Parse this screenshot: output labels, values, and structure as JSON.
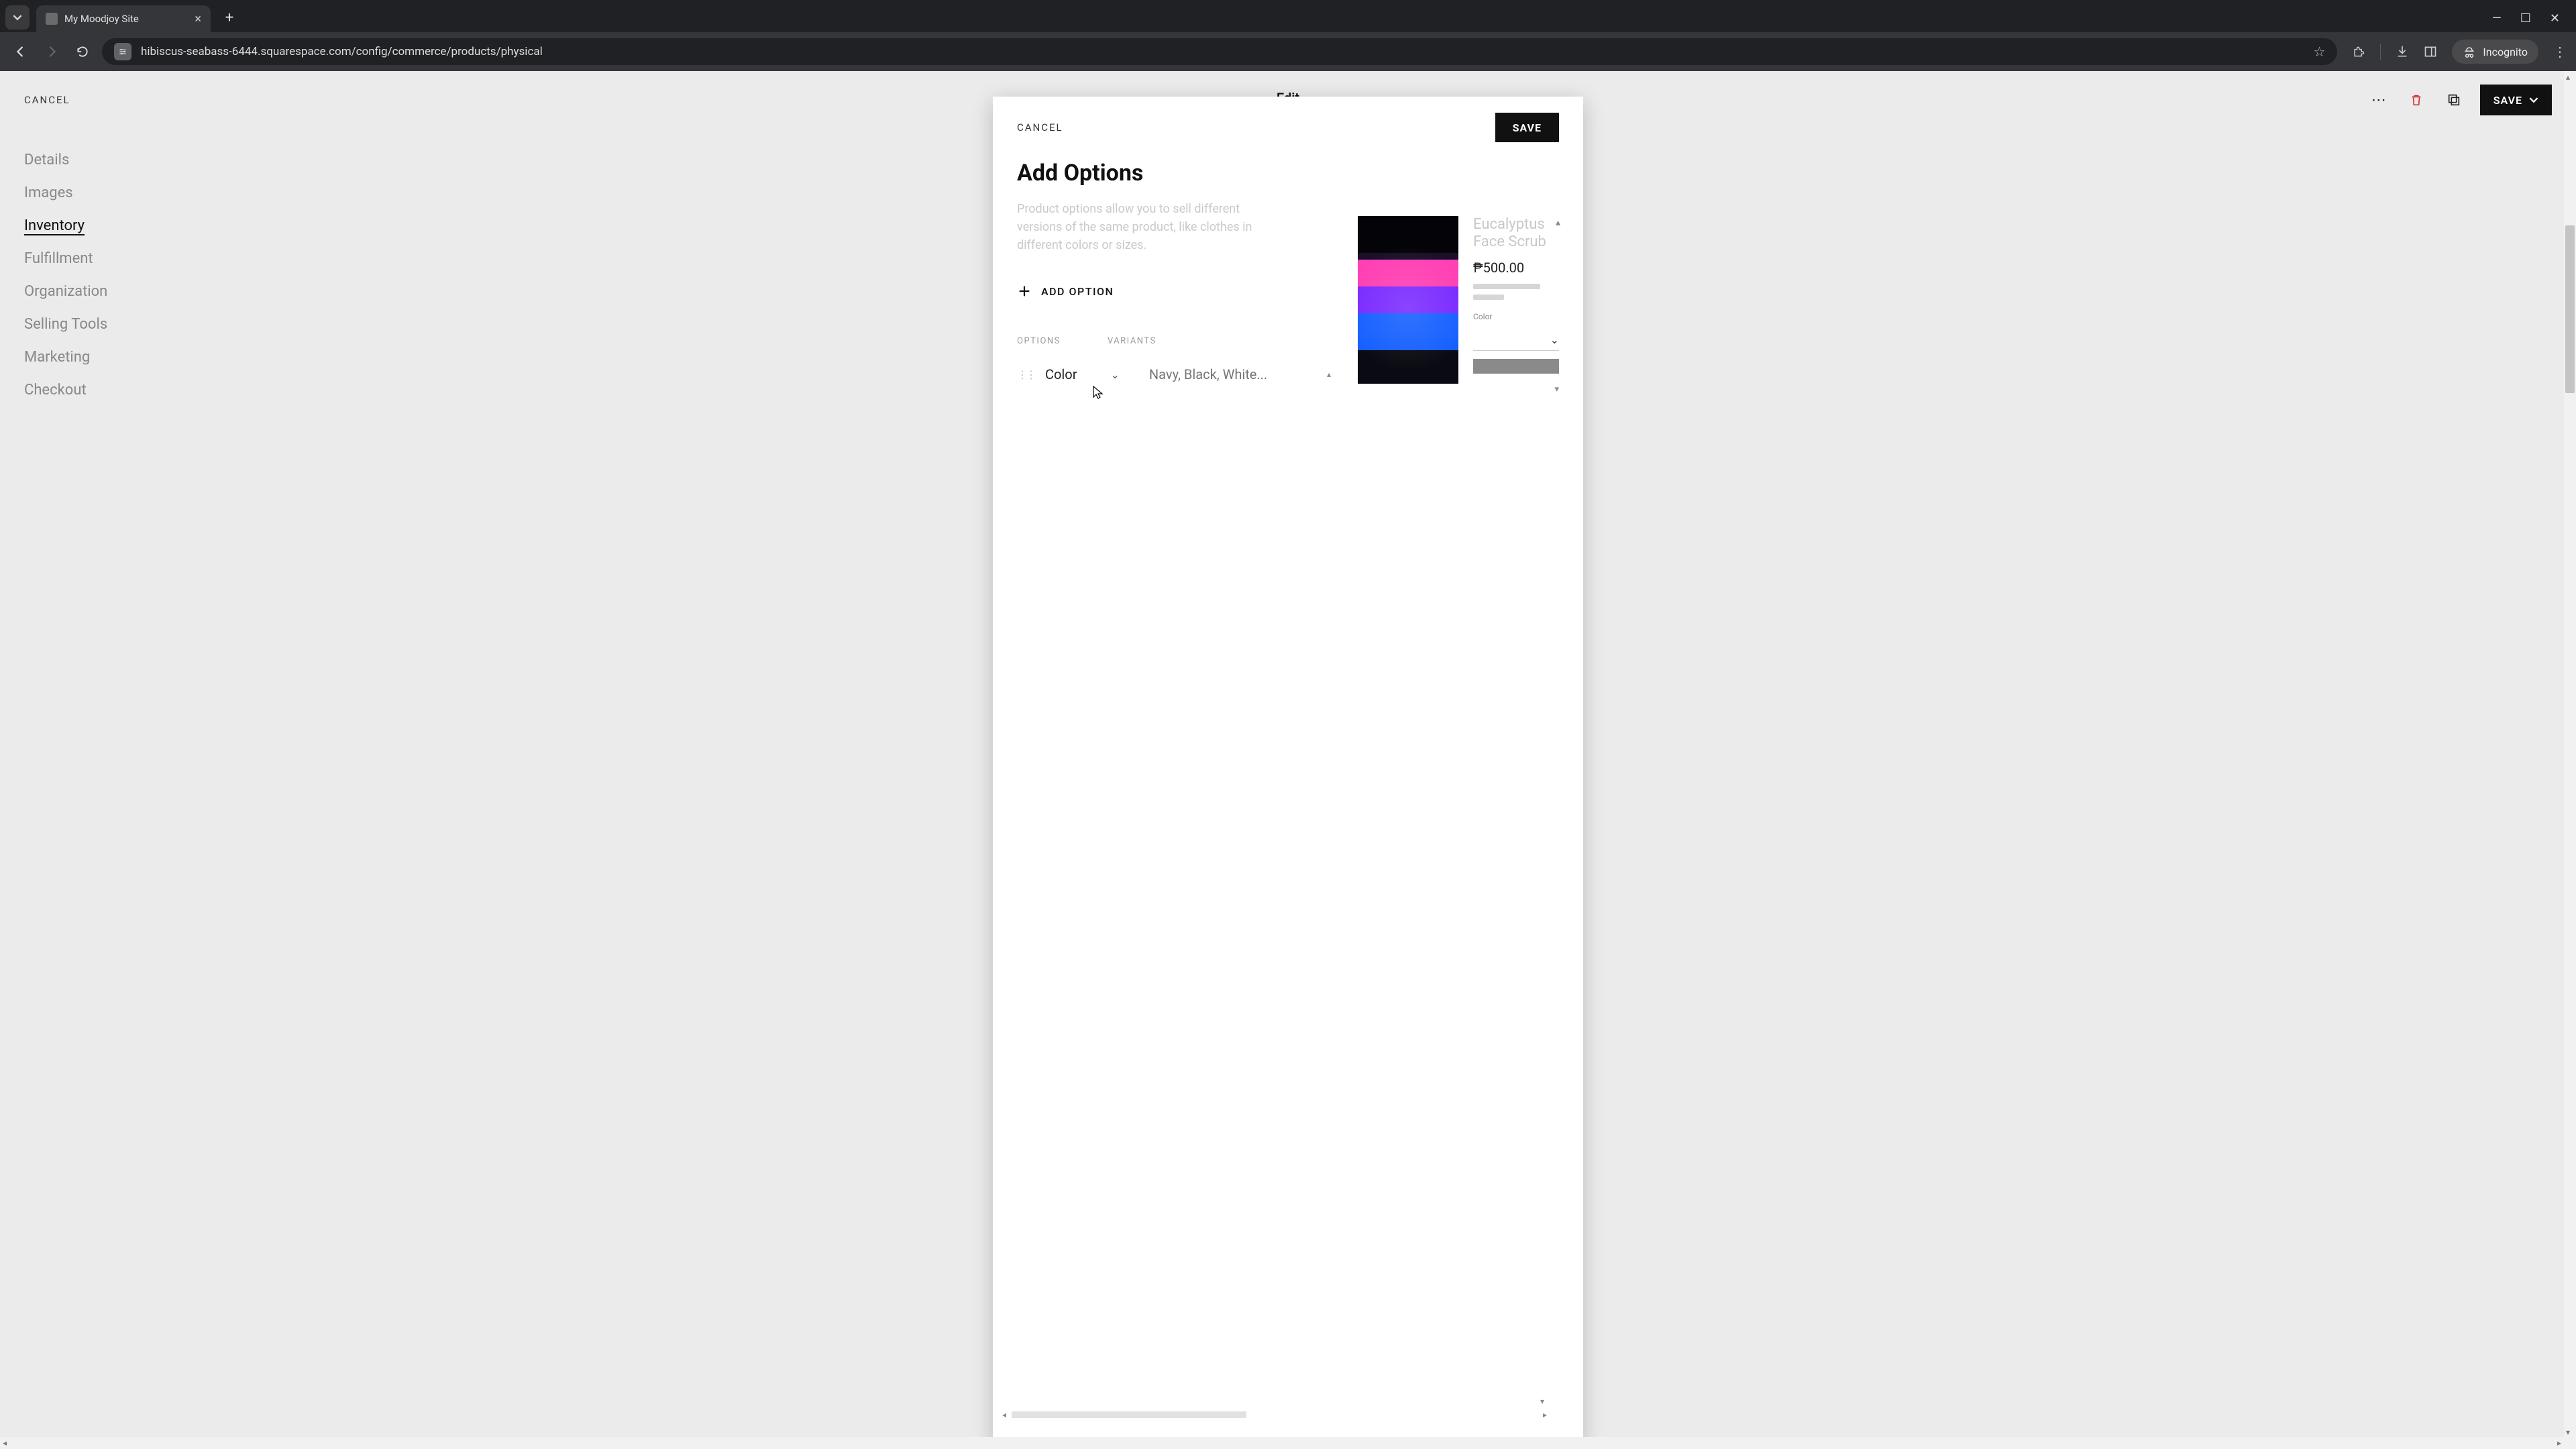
{
  "browser": {
    "tab_title": "My Moodjoy Site",
    "url": "hibiscus-seabass-6444.squarespace.com/config/commerce/products/physical",
    "incognito_label": "Incognito"
  },
  "page": {
    "cancel": "CANCEL",
    "edit": "Edit",
    "save": "SAVE"
  },
  "sidebar": {
    "items": [
      {
        "label": "Details"
      },
      {
        "label": "Images"
      },
      {
        "label": "Inventory"
      },
      {
        "label": "Fulfillment"
      },
      {
        "label": "Organization"
      },
      {
        "label": "Selling Tools"
      },
      {
        "label": "Marketing"
      },
      {
        "label": "Checkout"
      }
    ],
    "active_index": 2
  },
  "modal": {
    "cancel": "CANCEL",
    "save": "SAVE",
    "title": "Add Options",
    "subtitle": "Product options allow you to sell different versions of the same product, like clothes in different colors or sizes.",
    "add_option": "ADD OPTION",
    "col_options": "OPTIONS",
    "col_variants": "VARIANTS",
    "option_name": "Color",
    "variants_placeholder": "Navy, Black, White..."
  },
  "preview": {
    "name": "Eucalyptus Face Scrub",
    "price": "₱500.00",
    "color_label": "Color"
  }
}
